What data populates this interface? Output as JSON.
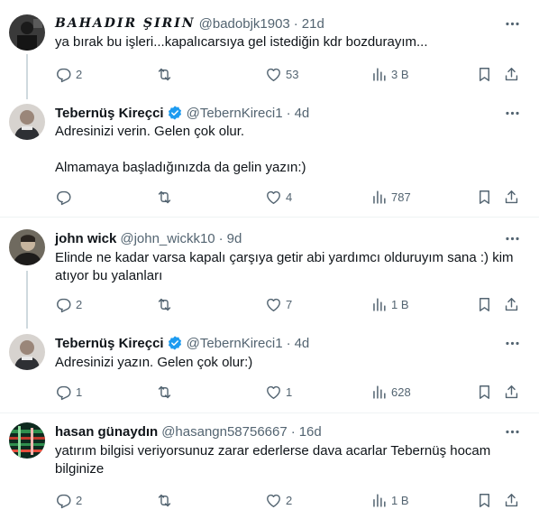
{
  "tweets": [
    {
      "name": "BAHADIR ŞIRIN",
      "handle": "@badobjk1903",
      "time": "21d",
      "lines": [
        "ya bırak bu işleri...kapalıcarsıya gel istediğin kdr bozdurayım..."
      ],
      "replies": "2",
      "reposts": "",
      "likes": "53",
      "views": "3 B"
    },
    {
      "name": "Tebernüş Kireçci",
      "handle": "@TebernKireci1",
      "time": "4d",
      "verified": true,
      "lines": [
        "Adresinizi verin. Gelen çok olur.",
        "",
        "Almamaya başladığınızda da gelin yazın:)"
      ],
      "replies": "",
      "reposts": "",
      "likes": "4",
      "views": "787"
    },
    {
      "name": "john wick",
      "handle": "@john_wickk10",
      "time": "9d",
      "lines": [
        "Elinde ne kadar varsa kapalı çarşıya getir abi yardımcı olduruyım sana :) kim",
        "atıyor bu yalanları"
      ],
      "replies": "2",
      "reposts": "",
      "likes": "7",
      "views": "1 B"
    },
    {
      "name": "Tebernüş Kireçci",
      "handle": "@TebernKireci1",
      "time": "4d",
      "verified": true,
      "lines": [
        "Adresinizi yazın. Gelen çok olur:)"
      ],
      "replies": "1",
      "reposts": "",
      "likes": "1",
      "views": "628"
    },
    {
      "name": "hasan günaydın",
      "handle": "@hasangn58756667",
      "time": "16d",
      "lines": [
        "yatırım bilgisi veriyorsunuz zarar ederlerse dava acarlar Tebernüş hocam",
        "bilginize"
      ],
      "replies": "2",
      "reposts": "",
      "likes": "2",
      "views": "1 B"
    }
  ],
  "colors": {
    "text": "#0f1419",
    "secondary": "#536471",
    "verified": "#1d9bf0",
    "divider": "#eff3f4",
    "thread": "#cfd9de"
  },
  "icons": [
    "reply-icon",
    "repost-icon",
    "like-icon",
    "views-icon",
    "bookmark-icon",
    "share-icon",
    "more-icon",
    "verified-icon"
  ]
}
